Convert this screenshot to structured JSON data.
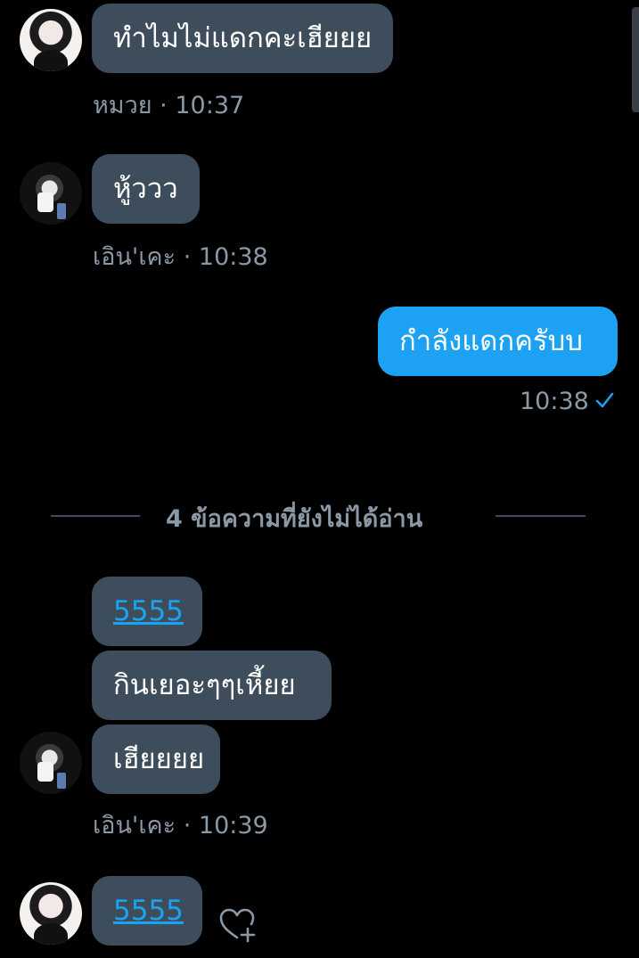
{
  "messages": [
    {
      "text": "ทำไมไม่แดกคะเฮียยย",
      "sender": "หมวย",
      "time": "10:37"
    },
    {
      "text": "หู้ววว",
      "sender": "เอิน'เคะ",
      "time": "10:38"
    },
    {
      "text": "กำลังแดกครับบ",
      "time": "10:38"
    }
  ],
  "unread_divider": "4 ข้อความที่ยังไม่ได้อ่าน",
  "unread_group": {
    "messages": [
      "5555",
      "กินเยอะๆๆเหี้ยย",
      "เฮียยยย"
    ],
    "sender": "เอิน'เคะ",
    "time": "10:39"
  },
  "last_message": {
    "text": "5555"
  },
  "meta_separator": "·",
  "colors": {
    "background": "#000000",
    "incoming_bubble": "#3e4d5c",
    "outgoing_bubble": "#1da1f2",
    "link": "#1da1f2",
    "meta_text": "#8b98a5"
  },
  "icons": [
    "check-icon",
    "heart-plus-icon"
  ]
}
